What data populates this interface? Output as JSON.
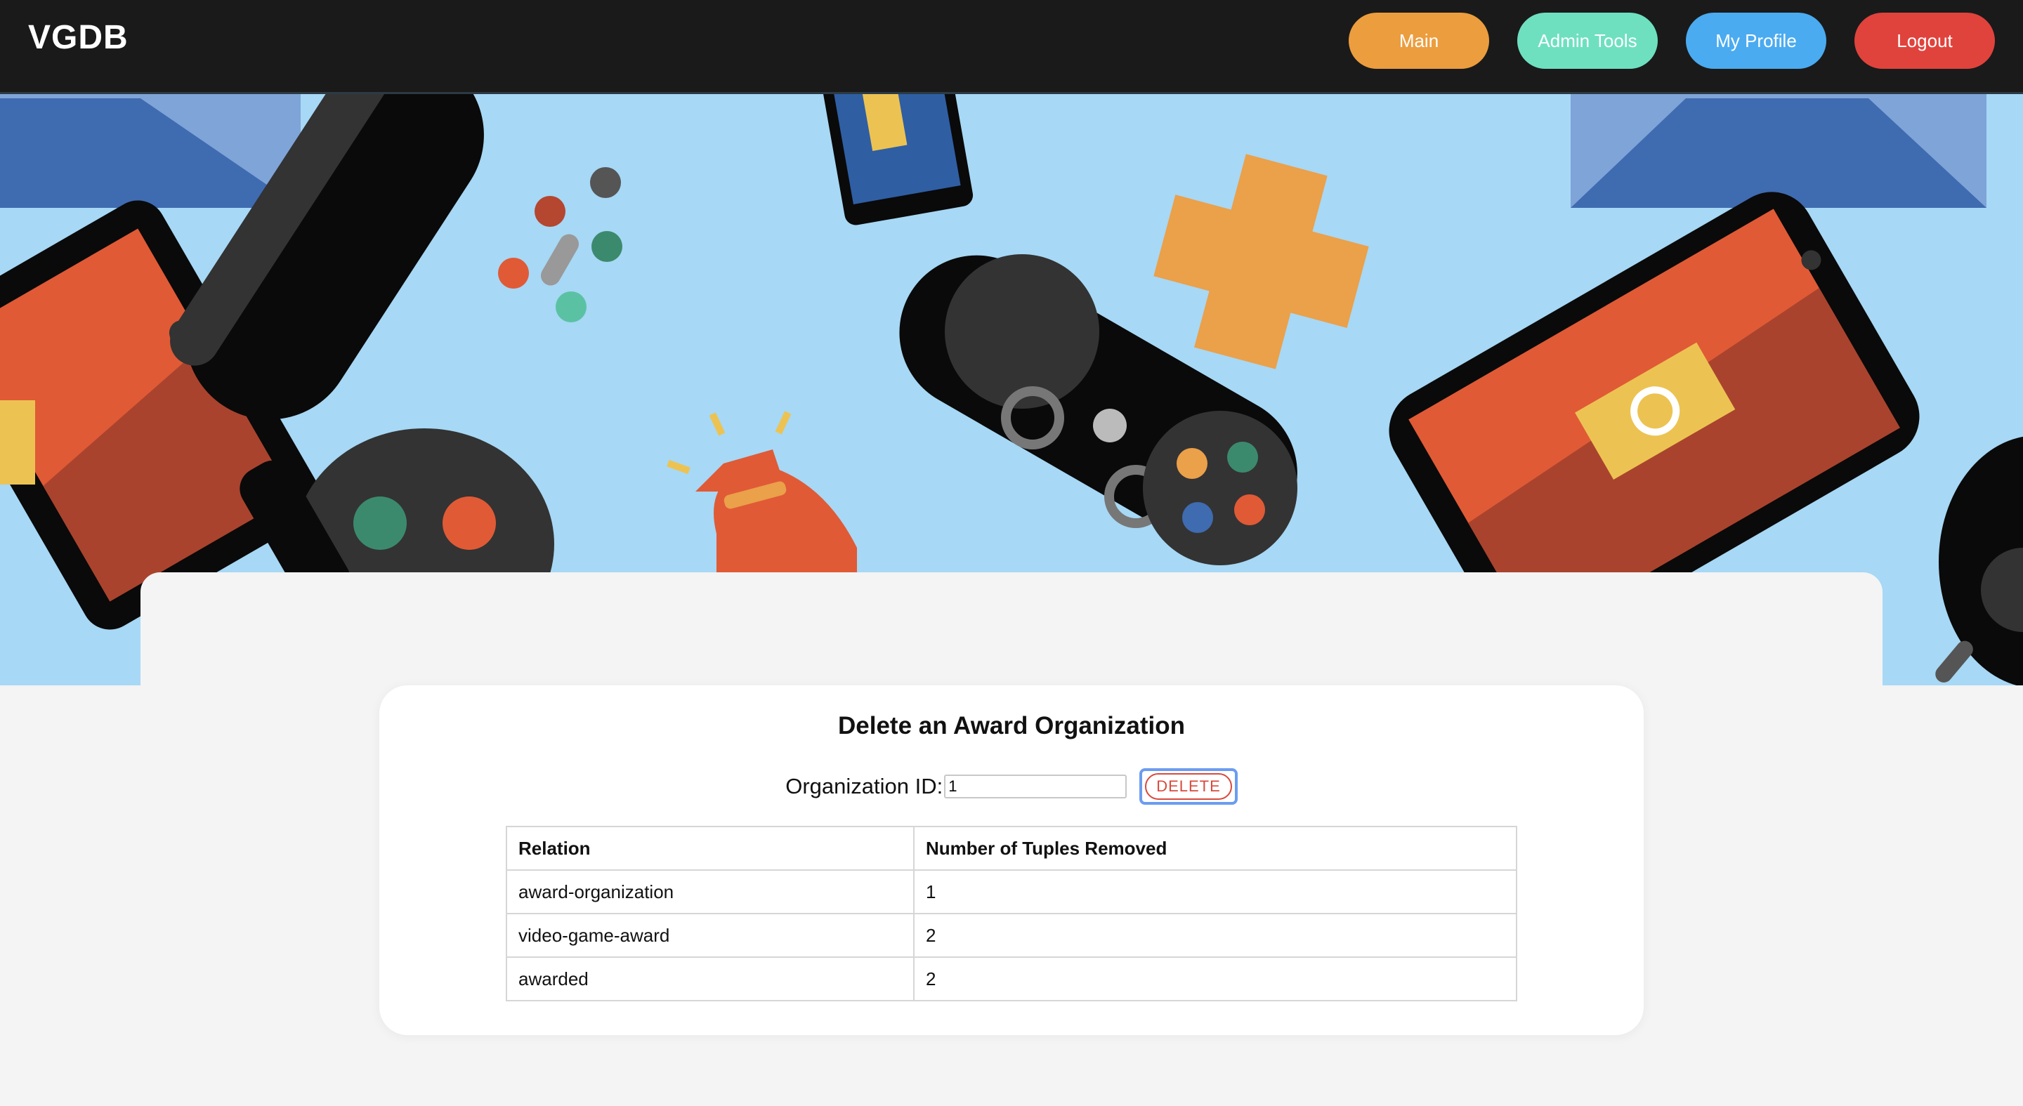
{
  "navbar": {
    "brand": "VGDB",
    "buttons": [
      {
        "label": "Main",
        "color": "#ec9d3e"
      },
      {
        "label": "Admin Tools",
        "color": "#6ee0c0"
      },
      {
        "label": "My Profile",
        "color": "#4aabf0"
      },
      {
        "label": "Logout",
        "color": "#e0433c"
      }
    ]
  },
  "hero": {
    "background": "#a7d8f5"
  },
  "form": {
    "title": "Delete an Award Organization",
    "org_label": "Organization ID:",
    "org_value": "1",
    "delete_label": "DELETE"
  },
  "results": {
    "headers": [
      "Relation",
      "Number of Tuples Removed"
    ],
    "rows": [
      [
        "award-organization",
        "1"
      ],
      [
        "video-game-award",
        "2"
      ],
      [
        "awarded",
        "2"
      ]
    ]
  },
  "colors": {
    "accent_delete": "#d74a3d",
    "navbar_bg": "#1a1a1a",
    "page_bg": "#f4f4f4"
  }
}
